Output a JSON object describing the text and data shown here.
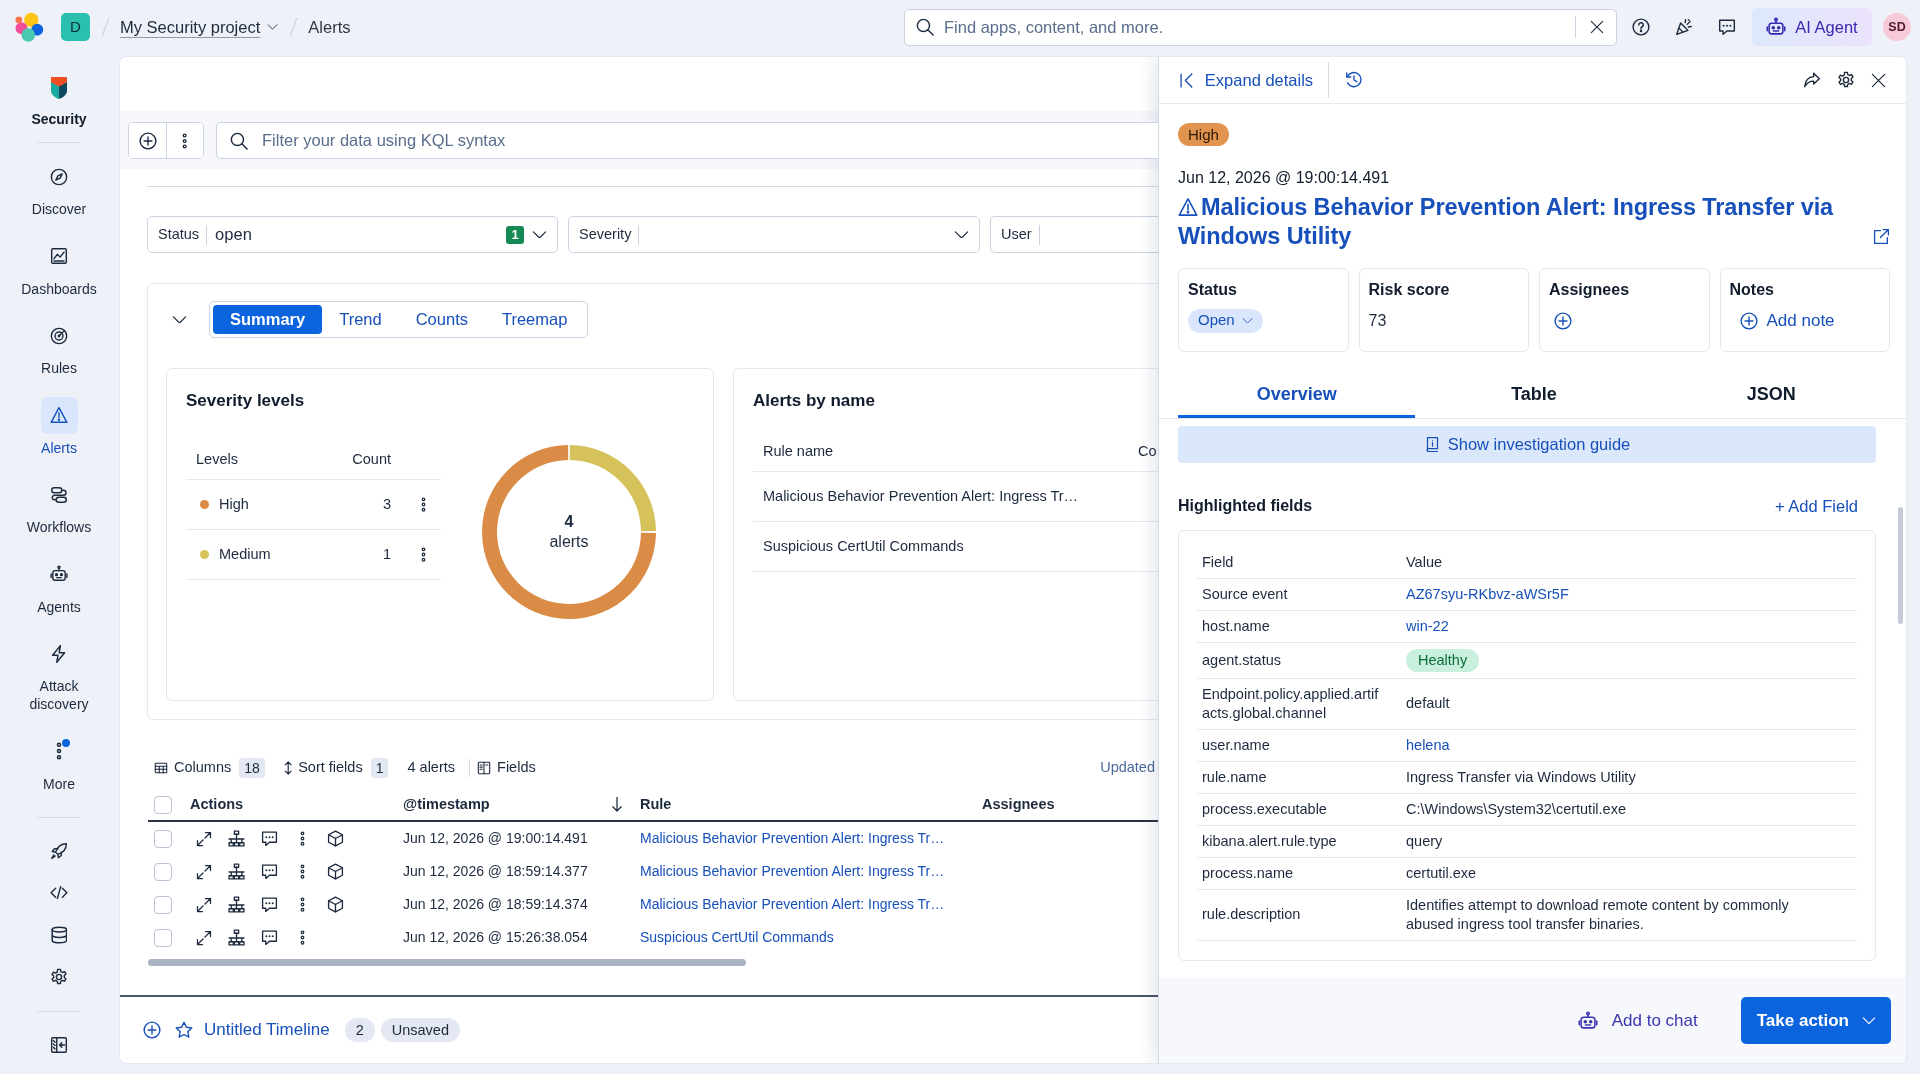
{
  "header": {
    "space_initial": "D",
    "breadcrumbs": [
      {
        "label": "My Security project",
        "kind": "menu"
      },
      {
        "label": "Alerts",
        "kind": "current"
      }
    ],
    "search": {
      "placeholder": "Find apps, content, and more."
    },
    "ai_button": "AI Agent",
    "user_initials": "SD"
  },
  "sidebar": {
    "app": "Security",
    "items": [
      {
        "label": "Discover",
        "selected": false,
        "notify": false
      },
      {
        "label": "Dashboards",
        "selected": false,
        "notify": false
      },
      {
        "label": "Rules",
        "selected": false,
        "notify": false
      },
      {
        "label": "Alerts",
        "selected": true,
        "notify": false
      },
      {
        "label": "Workflows",
        "selected": false,
        "notify": false
      },
      {
        "label": "Agents",
        "selected": false,
        "notify": false
      },
      {
        "label": "Attack discovery",
        "selected": false,
        "notify": false
      },
      {
        "label": "More",
        "selected": false,
        "notify": true
      }
    ]
  },
  "query_bar": {
    "placeholder": "Filter your data using KQL syntax"
  },
  "filters": [
    {
      "label": "Status",
      "value": "open",
      "count": "1"
    },
    {
      "label": "Severity"
    },
    {
      "label": "User"
    }
  ],
  "summary": {
    "expanded": true,
    "tabs": [
      {
        "label": "Summary",
        "selected": true
      },
      {
        "label": "Trend",
        "selected": false
      },
      {
        "label": "Counts",
        "selected": false
      },
      {
        "label": "Treemap",
        "selected": false
      }
    ],
    "severity_levels": {
      "title": "Severity levels",
      "columns": [
        "Levels",
        "Count"
      ],
      "rows": [
        {
          "level": "High",
          "count": "3",
          "color": "#da8b45"
        },
        {
          "level": "Medium",
          "count": "1",
          "color": "#d6c25a"
        }
      ],
      "total": "4",
      "total_label": "alerts",
      "chart_data": {
        "type": "donut",
        "values": [
          75,
          25
        ]
      }
    },
    "alerts_by_name": {
      "title": "Alerts by name",
      "columns": [
        "Rule name",
        "Co"
      ],
      "rows": [
        {
          "rule_name": "Malicious Behavior Prevention Alert: Ingress Tr…"
        },
        {
          "rule_name": "Suspicious CertUtil Commands"
        }
      ]
    }
  },
  "toolbar": {
    "columns": {
      "label": "Columns",
      "count": "18"
    },
    "sort_fields": {
      "label": "Sort fields",
      "count": "1"
    },
    "alert_count": "4 alerts",
    "fields": "Fields",
    "updated": "Updated"
  },
  "alerts_table": {
    "all_checked": false,
    "columns": [
      {
        "label": "Actions",
        "sorted": false
      },
      {
        "label": "@timestamp",
        "sorted": true
      },
      {
        "label": "Rule",
        "sorted": false
      },
      {
        "label": "Assignees",
        "sorted": false
      }
    ],
    "rows": [
      {
        "checked": false,
        "cube_action": true,
        "timestamp": "Jun 12, 2026 @ 19:00:14.491",
        "rule": "Malicious Behavior Prevention Alert: Ingress Tr…"
      },
      {
        "checked": false,
        "cube_action": true,
        "timestamp": "Jun 12, 2026 @ 18:59:14.377",
        "rule": "Malicious Behavior Prevention Alert: Ingress Tr…"
      },
      {
        "checked": false,
        "cube_action": true,
        "timestamp": "Jun 12, 2026 @ 18:59:14.374",
        "rule": "Malicious Behavior Prevention Alert: Ingress Tr…"
      },
      {
        "checked": false,
        "cube_action": false,
        "timestamp": "Jun 12, 2026 @ 15:26:38.054",
        "rule": "Suspicious CertUtil Commands"
      }
    ]
  },
  "timeline": {
    "title": "Untitled Timeline",
    "count": "2",
    "status": "Unsaved"
  },
  "flyout": {
    "expand_label": "Expand details",
    "severity": "High",
    "timestamp": "Jun 12, 2026 @ 19:00:14.491",
    "title": "Malicious Behavior Prevention Alert: Ingress Transfer via Windows Utility",
    "cards": [
      {
        "label": "Status",
        "kind": "status",
        "value": "Open"
      },
      {
        "label": "Risk score",
        "kind": "text",
        "value": "73"
      },
      {
        "label": "Assignees",
        "kind": "add"
      },
      {
        "label": "Notes",
        "kind": "add",
        "value": "Add note"
      }
    ],
    "tabs": [
      {
        "label": "Overview",
        "selected": true
      },
      {
        "label": "Table",
        "selected": false
      },
      {
        "label": "JSON",
        "selected": false
      }
    ],
    "guide_button": "Show investigation guide",
    "highlighted_fields": {
      "title": "Highlighted fields",
      "add_label": "+ Add Field",
      "columns": [
        "Field",
        "Value"
      ],
      "rows": [
        {
          "field": "Source event",
          "value": "AZ67syu-RKbvz-aWSr5F",
          "kind": "link"
        },
        {
          "field": "host.name",
          "value": "win-22",
          "kind": "link"
        },
        {
          "field": "agent.status",
          "value": "Healthy",
          "kind": "badge"
        },
        {
          "field": "Endpoint.policy.applied.artifacts.global.channel",
          "value": "default",
          "kind": "text"
        },
        {
          "field": "user.name",
          "value": "helena",
          "kind": "link"
        },
        {
          "field": "rule.name",
          "value": "Ingress Transfer via Windows Utility",
          "kind": "text"
        },
        {
          "field": "process.executable",
          "value": "C:\\Windows\\System32\\certutil.exe",
          "kind": "text"
        },
        {
          "field": "kibana.alert.rule.type",
          "value": "query",
          "kind": "text"
        },
        {
          "field": "process.name",
          "value": "certutil.exe",
          "kind": "text"
        },
        {
          "field": "rule.description",
          "value": "Identifies attempt to download remote content by commonly abused ingress tool transfer binaries.",
          "kind": "text"
        }
      ]
    },
    "footer": {
      "chat_label": "Add to chat",
      "action_label": "Take action"
    }
  }
}
